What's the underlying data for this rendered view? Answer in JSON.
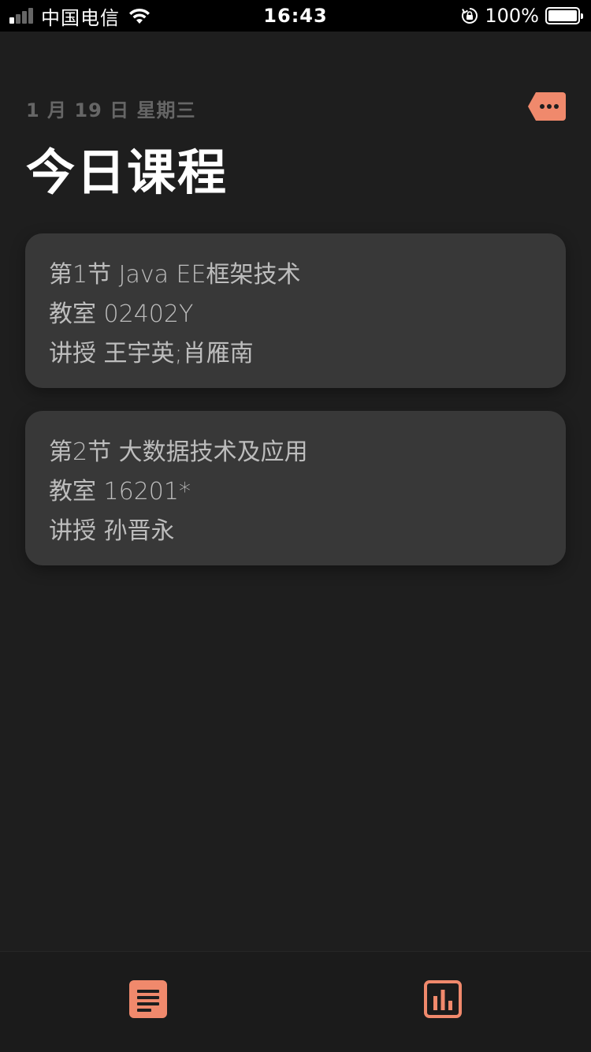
{
  "status_bar": {
    "carrier": "中国电信",
    "time": "16:43",
    "battery": "100%",
    "signal_bars_filled": 1,
    "signal_bars_total": 4
  },
  "header": {
    "date": "1 月 19 日 星期三",
    "title": "今日课程",
    "more_icon": "more-tag-icon"
  },
  "courses": [
    {
      "line1": "第1节 Java EE框架技术",
      "line2": "教室 02402Y",
      "line3": "讲授 王宇英;肖雁南"
    },
    {
      "line1": "第2节 大数据技术及应用",
      "line2": "教室 16201*",
      "line3": "讲授 孙晋永"
    }
  ],
  "tab_bar": {
    "tabs": [
      {
        "icon": "document-list-icon"
      },
      {
        "icon": "bar-chart-icon"
      }
    ]
  },
  "colors": {
    "accent": "#f0896c",
    "background": "#1e1e1e",
    "card": "#383838"
  }
}
